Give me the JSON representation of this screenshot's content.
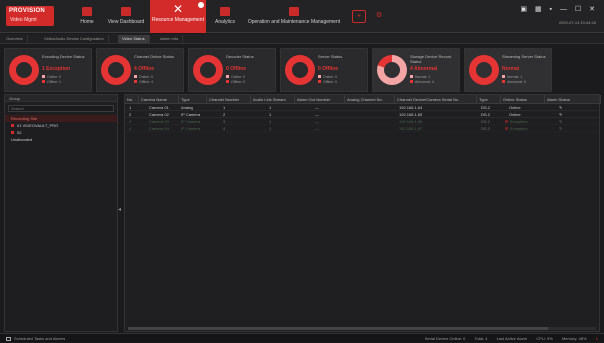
{
  "app": {
    "logo_line1": "PROVISION",
    "logo_line2": "Video Mgmt",
    "window_controls": "▣ ▦ ▪ — ☐ ✕",
    "datetime": "2020-07-13 10:44:26"
  },
  "nav": {
    "items": [
      {
        "label": "Home"
      },
      {
        "label": "View Dashboard"
      },
      {
        "label": "Resource Management"
      },
      {
        "label": "Analytics"
      },
      {
        "label": "Operation and Maintenance Management"
      }
    ],
    "icon_buttons": [
      "plus-icon",
      "settings-icon"
    ]
  },
  "tabs": [
    {
      "label": "Overview"
    },
    {
      "label": "Video/Audio Device Configuration"
    },
    {
      "label": "Video Status"
    },
    {
      "label": "Alarm Info"
    }
  ],
  "cards": [
    {
      "title": "Encoding Device Status",
      "value": "1 Exception",
      "legend": [
        "Online: 0",
        "Offline: 1"
      ]
    },
    {
      "title": "Channel Online Status",
      "value": "4 Offline",
      "legend": [
        "Online: 0",
        "Offline: 4"
      ]
    },
    {
      "title": "Decoder Status",
      "value": "0 Offline",
      "legend": [
        "Online: 0",
        "Offline: 0"
      ]
    },
    {
      "title": "Server Status",
      "value": "0 Offline",
      "legend": [
        "Online: 0",
        "Offline: 0"
      ]
    },
    {
      "title": "Storage Device Record Status",
      "value": "4 Abnormal",
      "legend": [
        "Normal: 1",
        "Abnormal: 4"
      ]
    },
    {
      "title": "Streaming Server Status",
      "value": "Normal",
      "legend": [
        "Normal: 1",
        "Abnormal: 0"
      ]
    }
  ],
  "sidebar": {
    "heading": "Group",
    "search_placeholder": "Search",
    "tree": [
      {
        "label": "Recording Site"
      },
      {
        "label": "01 VIDEOVAULT_PRO"
      },
      {
        "label": "02"
      },
      {
        "label": "Unallocated"
      }
    ]
  },
  "table": {
    "columns": [
      "No.",
      "Camera Name",
      "Type",
      "Channel Number",
      "Audio Link Stream",
      "Alarm Out Number",
      "Analog Channel No.",
      "Channel Device/Camera Serial No.",
      "Type",
      "Online Status",
      "Alarm Status"
    ],
    "rows": [
      {
        "no": "1",
        "name": "Camera 01",
        "type": "Analog",
        "ch": "1",
        "audio": "1",
        "alarm": "—",
        "ip": "192.168.1.64",
        "model": "DS-2",
        "status": "Online",
        "dim": false
      },
      {
        "no": "2",
        "name": "Camera 02",
        "type": "IP Camera",
        "ch": "2",
        "audio": "1",
        "alarm": "—",
        "ip": "192.168.1.65",
        "model": "DS-2",
        "status": "Online",
        "dim": false
      },
      {
        "no": "3",
        "name": "Camera 03",
        "type": "IP Camera",
        "ch": "3",
        "audio": "1",
        "alarm": "—",
        "ip": "192.168.1.66",
        "model": "DS-2",
        "status": "Exception",
        "dim": true
      },
      {
        "no": "4",
        "name": "Camera 04",
        "type": "IP Camera",
        "ch": "4",
        "audio": "1",
        "alarm": "—",
        "ip": "192.168.1.67",
        "model": "DS-2",
        "status": "Exception",
        "dim": true
      }
    ]
  },
  "status": {
    "left": "Scheduled Tasks and Alarms",
    "items": [
      "Serial Device Online: 0",
      "Total: 4",
      "Last Active Alarm",
      "CPU: 9%",
      "Memory: 48%"
    ],
    "alert": "1"
  },
  "colors": {
    "accent": "#d32a2a",
    "light_accent": "#f3a4a4",
    "background": "#1b1b1d"
  }
}
